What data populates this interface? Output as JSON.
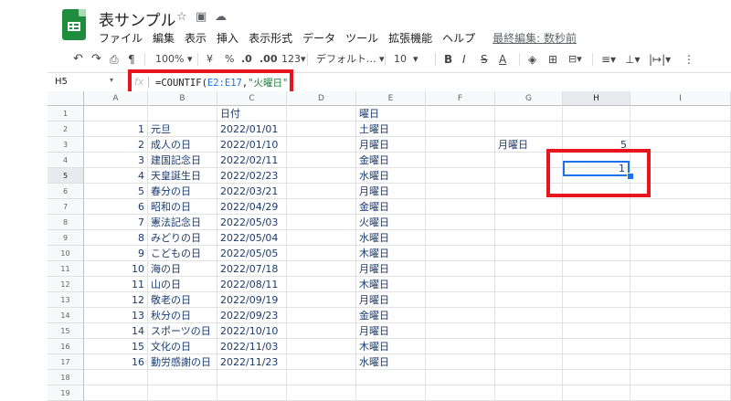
{
  "app": {
    "title": "表サンプル",
    "menu": [
      "ファイル",
      "編集",
      "表示",
      "挿入",
      "表示形式",
      "データ",
      "ツール",
      "拡張機能",
      "ヘルプ"
    ],
    "last_edit": "最終編集: 数秒前"
  },
  "toolbar": {
    "zoom": "100%",
    "currency": "¥",
    "percent": "%",
    "dec_less": ".0",
    "dec_more": ".00",
    "more_formats": "123",
    "font": "デフォルト...",
    "font_size": "10",
    "bold": "B",
    "italic": "I",
    "strike": "S",
    "text_color": "A"
  },
  "formula_bar": {
    "name_box": "H5",
    "fx": "fx",
    "formula_prefix": "=COUNTIF(",
    "formula_ref": "E2:E17",
    "formula_mid": ",",
    "formula_str": "\"火曜日\"",
    "formula_suffix": ")"
  },
  "columns": [
    "A",
    "B",
    "C",
    "D",
    "E",
    "F",
    "G",
    "H",
    "I"
  ],
  "rows": [
    {
      "n": "1",
      "a": "",
      "b": "",
      "c": "日付",
      "e": "曜日",
      "g": "",
      "h": ""
    },
    {
      "n": "2",
      "a": "1",
      "b": "元旦",
      "c": "2022/01/01",
      "e": "土曜日",
      "g": "",
      "h": ""
    },
    {
      "n": "3",
      "a": "2",
      "b": "成人の日",
      "c": "2022/01/10",
      "e": "月曜日",
      "g": "月曜日",
      "h": "5"
    },
    {
      "n": "4",
      "a": "3",
      "b": "建国記念日",
      "c": "2022/02/11",
      "e": "金曜日",
      "g": "",
      "h": ""
    },
    {
      "n": "5",
      "a": "4",
      "b": "天皇誕生日",
      "c": "2022/02/23",
      "e": "水曜日",
      "g": "",
      "h": ""
    },
    {
      "n": "6",
      "a": "5",
      "b": "春分の日",
      "c": "2022/03/21",
      "e": "月曜日",
      "g": "",
      "h": ""
    },
    {
      "n": "7",
      "a": "6",
      "b": "昭和の日",
      "c": "2022/04/29",
      "e": "金曜日",
      "g": "",
      "h": ""
    },
    {
      "n": "8",
      "a": "7",
      "b": "憲法記念日",
      "c": "2022/05/03",
      "e": "火曜日",
      "g": "",
      "h": ""
    },
    {
      "n": "9",
      "a": "8",
      "b": "みどりの日",
      "c": "2022/05/04",
      "e": "水曜日",
      "g": "",
      "h": ""
    },
    {
      "n": "10",
      "a": "9",
      "b": "こどもの日",
      "c": "2022/05/05",
      "e": "木曜日",
      "g": "",
      "h": ""
    },
    {
      "n": "11",
      "a": "10",
      "b": "海の日",
      "c": "2022/07/18",
      "e": "月曜日",
      "g": "",
      "h": ""
    },
    {
      "n": "12",
      "a": "11",
      "b": "山の日",
      "c": "2022/08/11",
      "e": "木曜日",
      "g": "",
      "h": ""
    },
    {
      "n": "13",
      "a": "12",
      "b": "敬老の日",
      "c": "2022/09/19",
      "e": "月曜日",
      "g": "",
      "h": ""
    },
    {
      "n": "14",
      "a": "13",
      "b": "秋分の日",
      "c": "2022/09/23",
      "e": "金曜日",
      "g": "",
      "h": ""
    },
    {
      "n": "15",
      "a": "14",
      "b": "スポーツの日",
      "c": "2022/10/10",
      "e": "月曜日",
      "g": "",
      "h": ""
    },
    {
      "n": "16",
      "a": "15",
      "b": "文化の日",
      "c": "2022/11/03",
      "e": "木曜日",
      "g": "",
      "h": ""
    },
    {
      "n": "17",
      "a": "16",
      "b": "勤労感謝の日",
      "c": "2022/11/23",
      "e": "水曜日",
      "g": "",
      "h": ""
    },
    {
      "n": "18",
      "a": "",
      "b": "",
      "c": "",
      "e": "",
      "g": "",
      "h": ""
    },
    {
      "n": "19",
      "a": "",
      "b": "",
      "c": "",
      "e": "",
      "g": "",
      "h": ""
    }
  ],
  "active_cell": {
    "ref": "H5",
    "value": "1"
  },
  "colors": {
    "highlight": "#e8141e",
    "selection": "#1a73e8",
    "brand": "#1e8e3e"
  }
}
